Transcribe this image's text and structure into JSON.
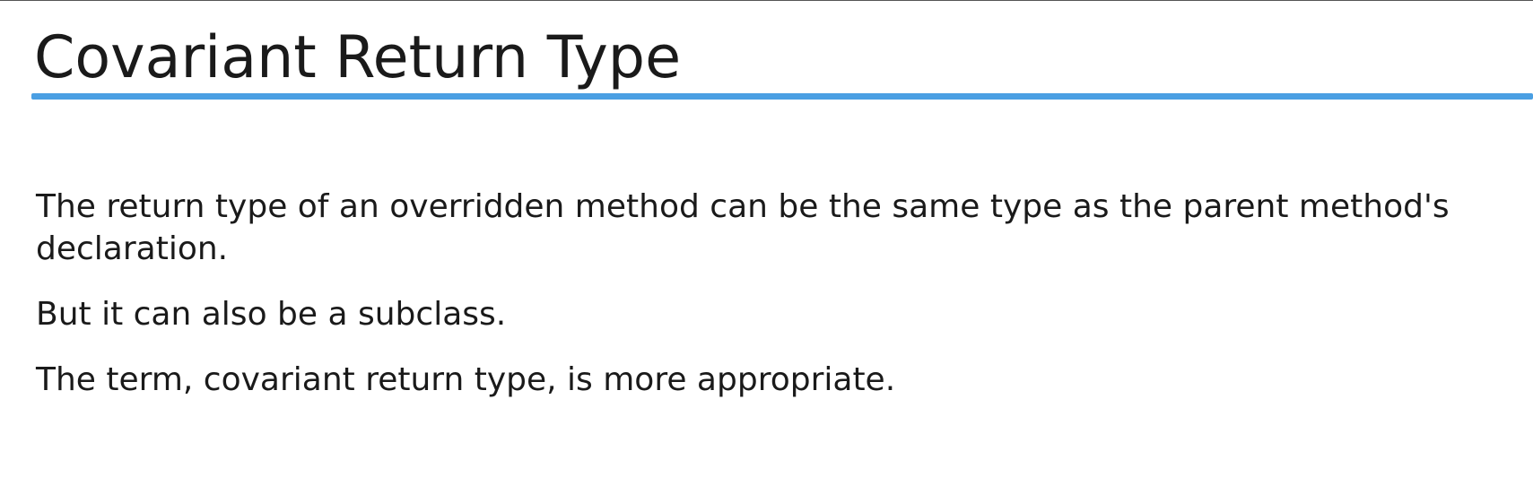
{
  "slide": {
    "title": "Covariant Return Type",
    "accent_color": "#4a9fe3",
    "paragraphs": [
      "The return type of an overridden method can be the same type as the parent method's declaration.",
      "But it can also be a subclass.",
      "The term, covariant return type, is more appropriate."
    ]
  }
}
